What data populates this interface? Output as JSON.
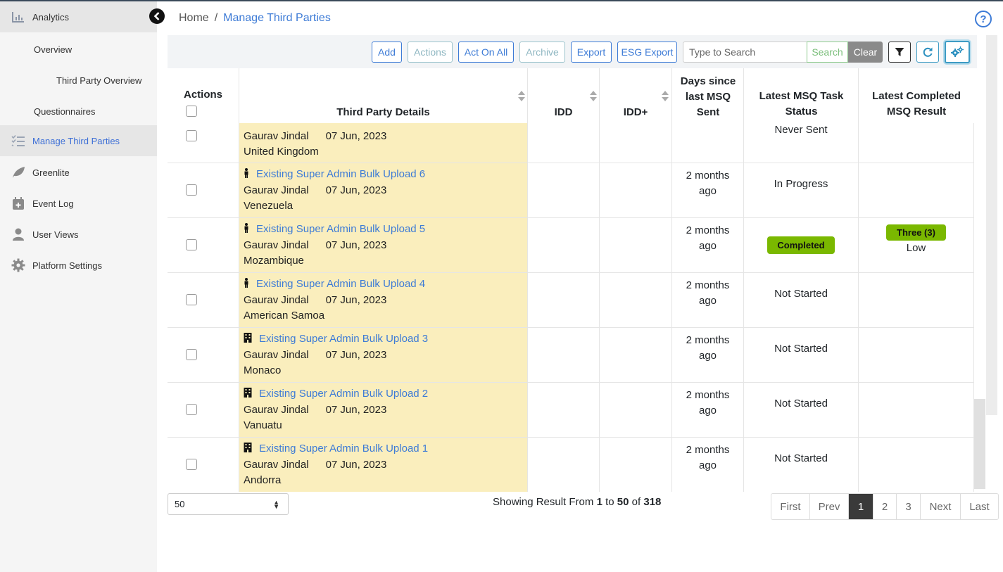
{
  "sidebar": {
    "items": [
      {
        "label": "Analytics",
        "icon": "bar-chart-icon"
      },
      {
        "label": "Overview"
      },
      {
        "label": "Third Party Overview"
      },
      {
        "label": "Questionnaires"
      },
      {
        "label": "Manage Third Parties",
        "icon": "checklist-icon"
      },
      {
        "label": "Greenlite",
        "icon": "leaf-icon"
      },
      {
        "label": "Event Log",
        "icon": "calendar-plus-icon"
      },
      {
        "label": "User Views",
        "icon": "user-icon"
      },
      {
        "label": "Platform Settings",
        "icon": "gear-icon"
      }
    ]
  },
  "breadcrumb": {
    "home": "Home",
    "separator": "/",
    "current": "Manage Third Parties"
  },
  "toolbar": {
    "add": "Add",
    "actions": "Actions",
    "act_on_all": "Act On All",
    "archive": "Archive",
    "export": "Export",
    "esg_export": "ESG Export",
    "search_placeholder": "Type to Search",
    "search": "Search",
    "clear": "Clear"
  },
  "table": {
    "headers": {
      "actions": "Actions",
      "third_party": "Third Party Details",
      "idd": "IDD",
      "idd_plus": "IDD+",
      "days": "Days since last MSQ Sent",
      "status": "Latest MSQ Task Status",
      "result": "Latest Completed MSQ Result"
    },
    "partial_row": {
      "user": "Gaurav Jindal",
      "date": "07 Jun, 2023",
      "country": "United Kingdom",
      "status": "Never Sent"
    },
    "rows": [
      {
        "type": "person",
        "name": "Existing Super Admin Bulk Upload 6",
        "user": "Gaurav Jindal",
        "date": "07 Jun, 2023",
        "country": "Venezuela",
        "days_line1": "2 months",
        "days_line2": "ago",
        "status": "In Progress",
        "status_badge": false,
        "result_badge": "",
        "result_text": ""
      },
      {
        "type": "person",
        "name": "Existing Super Admin Bulk Upload 5",
        "user": "Gaurav Jindal",
        "date": "07 Jun, 2023",
        "country": "Mozambique",
        "days_line1": "2 months",
        "days_line2": "ago",
        "status": "Completed",
        "status_badge": true,
        "result_badge": "Three (3)",
        "result_text": "Low"
      },
      {
        "type": "person",
        "name": "Existing Super Admin Bulk Upload 4",
        "user": "Gaurav Jindal",
        "date": "07 Jun, 2023",
        "country": "American Samoa",
        "days_line1": "2 months",
        "days_line2": "ago",
        "status": "Not Started",
        "status_badge": false,
        "result_badge": "",
        "result_text": ""
      },
      {
        "type": "building",
        "name": "Existing Super Admin Bulk Upload 3",
        "user": "Gaurav Jindal",
        "date": "07 Jun, 2023",
        "country": "Monaco",
        "days_line1": "2 months",
        "days_line2": "ago",
        "status": "Not Started",
        "status_badge": false,
        "result_badge": "",
        "result_text": ""
      },
      {
        "type": "building",
        "name": "Existing Super Admin Bulk Upload 2",
        "user": "Gaurav Jindal",
        "date": "07 Jun, 2023",
        "country": "Vanuatu",
        "days_line1": "2 months",
        "days_line2": "ago",
        "status": "Not Started",
        "status_badge": false,
        "result_badge": "",
        "result_text": ""
      },
      {
        "type": "building",
        "name": "Existing Super Admin Bulk Upload 1",
        "user": "Gaurav Jindal",
        "date": "07 Jun, 2023",
        "country": "Andorra",
        "days_line1": "2 months",
        "days_line2": "ago",
        "status": "Not Started",
        "status_badge": false,
        "result_badge": "",
        "result_text": ""
      }
    ]
  },
  "footer": {
    "page_size": "50",
    "showing_prefix": "Showing Result From",
    "from": "1",
    "to_word": "to",
    "to": "50",
    "of_word": "of",
    "total": "318",
    "pages": [
      "First",
      "Prev",
      "1",
      "2",
      "3",
      "Next",
      "Last"
    ],
    "current_page": "1"
  },
  "colors": {
    "accent": "#3d7bd6",
    "highlight_row": "#faeebd",
    "badge_green": "#7ab800",
    "pager_active": "#3a3a3a"
  }
}
